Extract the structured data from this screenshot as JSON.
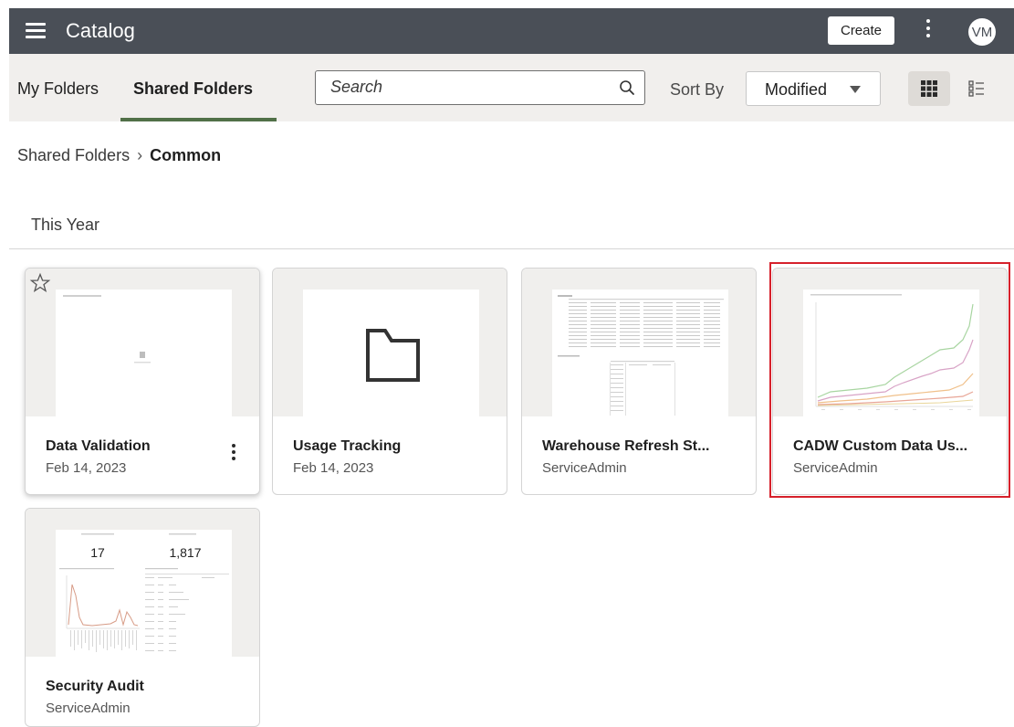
{
  "header": {
    "title": "Catalog",
    "create_label": "Create",
    "avatar_initials": "VM"
  },
  "tabs": [
    {
      "label": "My Folders",
      "active": false
    },
    {
      "label": "Shared Folders",
      "active": true
    }
  ],
  "search": {
    "placeholder": "Search",
    "value": ""
  },
  "sort": {
    "label": "Sort By",
    "selected": "Modified"
  },
  "view": {
    "active": "grid",
    "options": [
      "grid-view-icon",
      "list-view-icon"
    ]
  },
  "breadcrumb": {
    "parent": "Shared Folders",
    "current": "Common"
  },
  "section": {
    "title": "This Year"
  },
  "cards": [
    {
      "name": "Data Validation",
      "sub": "Feb 14, 2023",
      "thumb": "blank-report",
      "favorite_icon": true,
      "menu_icon": true
    },
    {
      "name": "Usage Tracking",
      "sub": "Feb 14, 2023",
      "thumb": "folder-icon"
    },
    {
      "name": "Warehouse Refresh St...",
      "sub": "ServiceAdmin",
      "thumb": "table-report"
    },
    {
      "name": "CADW Custom Data Us...",
      "sub": "ServiceAdmin",
      "thumb": "line-chart-report",
      "highlighted": true
    },
    {
      "name": "Security Audit",
      "sub": "ServiceAdmin",
      "thumb": "dashboard-report",
      "kpis": [
        "17",
        "1,817"
      ]
    }
  ],
  "colors": {
    "topbar": "#4a4f57",
    "subbar": "#f1efed",
    "tab_underline": "#517048",
    "highlight": "#d6212b"
  }
}
